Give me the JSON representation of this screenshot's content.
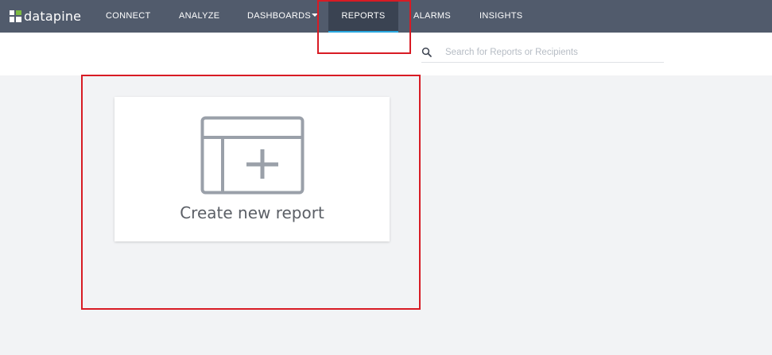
{
  "brand": {
    "name": "datapine"
  },
  "nav": {
    "items": [
      {
        "label": "CONNECT"
      },
      {
        "label": "ANALYZE"
      },
      {
        "label": "DASHBOARDS"
      },
      {
        "label": "REPORTS",
        "active": true
      },
      {
        "label": "ALARMS"
      },
      {
        "label": "INSIGHTS"
      }
    ]
  },
  "search": {
    "icon": "search-icon",
    "placeholder": "Search for Reports or Recipients",
    "value": ""
  },
  "create_card": {
    "icon": "add-report-icon",
    "label": "Create new report"
  },
  "colors": {
    "nav_background": "#515b6c",
    "nav_active_background": "#3a4352",
    "nav_active_underline": "#29a8e0",
    "page_background": "#f2f3f5",
    "icon_gray": "#9aa0a9",
    "highlight_red": "#d81b24",
    "brand_green": "#7dbb42"
  }
}
